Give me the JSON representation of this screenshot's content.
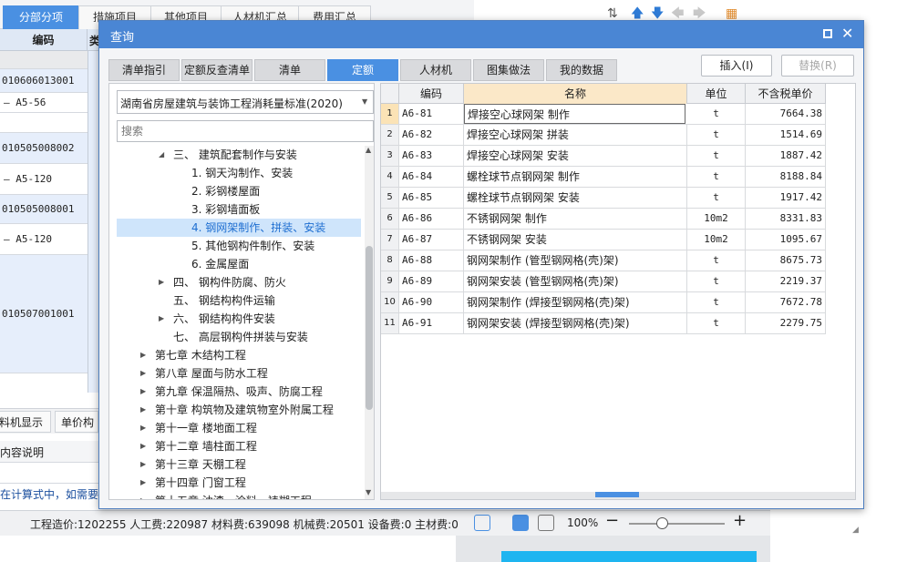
{
  "background": {
    "tabs": [
      "分部分项",
      "措施项目",
      "其他项目",
      "人材机汇总",
      "费用汇总"
    ],
    "column_header": "编码",
    "column_header_cut": "类",
    "rows": [
      {
        "text": "010606013001",
        "style": "blue"
      },
      {
        "text": "A5-56",
        "style": "white"
      },
      {
        "text": "",
        "style": "white"
      },
      {
        "text": "010505008002",
        "style": "blue"
      },
      {
        "text": "A5-120",
        "style": "white"
      },
      {
        "text": "010505008001",
        "style": "blue"
      },
      {
        "text": "A5-120",
        "style": "white"
      },
      {
        "text": "010507001001",
        "style": "blue"
      }
    ],
    "bottom_tabs": [
      "料机显示",
      "单价构"
    ],
    "sub_header": "内容说明",
    "hint": "在计算式中，如需要注",
    "status": {
      "cost_text": "工程造价:1202255  人工费:220987  材料费:639098  机械费:20501  设备费:0  主材费:0",
      "zoom": "100%",
      "zoom_fraction": 0.3
    }
  },
  "dialog": {
    "title": "查询",
    "tabs": [
      "清单指引",
      "定额反查清单",
      "清单",
      "定额",
      "人材机",
      "图集做法",
      "我的数据"
    ],
    "active_tab": "定额",
    "buttons": {
      "insert": "插入(I)",
      "replace": "替换(R)"
    },
    "standard_select": "湖南省房屋建筑与装饰工程消耗量标准(2020)",
    "search_placeholder": "搜索",
    "tree": [
      {
        "label": "三、 建筑配套制作与安装",
        "level": 1,
        "arrow": "down"
      },
      {
        "label": "1. 钢天沟制作、安装",
        "level": 2
      },
      {
        "label": "2. 彩钢楼屋面",
        "level": 2
      },
      {
        "label": "3. 彩钢墙面板",
        "level": 2
      },
      {
        "label": "4. 钢网架制作、拼装、安装",
        "level": 2,
        "selected": true
      },
      {
        "label": "5. 其他钢构件制作、安装",
        "level": 2
      },
      {
        "label": "6. 金属屋面",
        "level": 2
      },
      {
        "label": "四、 钢构件防腐、防火",
        "level": 1,
        "arrow": "right"
      },
      {
        "label": "五、 钢结构构件运输",
        "level": 1
      },
      {
        "label": "六、 钢结构构件安装",
        "level": 1,
        "arrow": "right"
      },
      {
        "label": "七、 高层钢构件拼装与安装",
        "level": 1
      },
      {
        "label": "第七章 木结构工程",
        "level": 0,
        "arrow": "right"
      },
      {
        "label": "第八章 屋面与防水工程",
        "level": 0,
        "arrow": "right"
      },
      {
        "label": "第九章 保温隔热、吸声、防腐工程",
        "level": 0,
        "arrow": "right"
      },
      {
        "label": "第十章 构筑物及建筑物室外附属工程",
        "level": 0,
        "arrow": "right"
      },
      {
        "label": "第十一章 楼地面工程",
        "level": 0,
        "arrow": "right"
      },
      {
        "label": "第十二章 墙柱面工程",
        "level": 0,
        "arrow": "right"
      },
      {
        "label": "第十三章 天棚工程",
        "level": 0,
        "arrow": "right"
      },
      {
        "label": "第十四章 门窗工程",
        "level": 0,
        "arrow": "right"
      },
      {
        "label": "第十五章 油漆、涂料、裱糊工程",
        "level": 0,
        "arrow": "right"
      }
    ],
    "grid": {
      "headers": {
        "index": "",
        "code": "编码",
        "name": "名称",
        "unit": "单位",
        "price": "不含税单价"
      },
      "rows": [
        {
          "idx": "1",
          "code": "A6-81",
          "name": "焊接空心球网架 制作",
          "unit": "t",
          "price": "7664.38"
        },
        {
          "idx": "2",
          "code": "A6-82",
          "name": "焊接空心球网架 拼装",
          "unit": "t",
          "price": "1514.69"
        },
        {
          "idx": "3",
          "code": "A6-83",
          "name": "焊接空心球网架 安装",
          "unit": "t",
          "price": "1887.42"
        },
        {
          "idx": "4",
          "code": "A6-84",
          "name": "螺栓球节点钢网架 制作",
          "unit": "t",
          "price": "8188.84"
        },
        {
          "idx": "5",
          "code": "A6-85",
          "name": "螺栓球节点钢网架 安装",
          "unit": "t",
          "price": "1917.42"
        },
        {
          "idx": "6",
          "code": "A6-86",
          "name": "不锈钢网架 制作",
          "unit": "10m2",
          "price": "8331.83"
        },
        {
          "idx": "7",
          "code": "A6-87",
          "name": "不锈钢网架 安装",
          "unit": "10m2",
          "price": "1095.67"
        },
        {
          "idx": "8",
          "code": "A6-88",
          "name": "钢网架制作 (管型钢网格(壳)架)",
          "unit": "t",
          "price": "8675.73"
        },
        {
          "idx": "9",
          "code": "A6-89",
          "name": "钢网架安装 (管型钢网格(壳)架)",
          "unit": "t",
          "price": "2219.37"
        },
        {
          "idx": "10",
          "code": "A6-90",
          "name": "钢网架制作 (焊接型钢网格(壳)架)",
          "unit": "t",
          "price": "7672.78"
        },
        {
          "idx": "11",
          "code": "A6-91",
          "name": "钢网架安装 (焊接型钢网格(壳)架)",
          "unit": "t",
          "price": "2279.75"
        }
      ]
    }
  },
  "icons": [
    "sort-icon",
    "arrow-up-icon",
    "arrow-down-icon",
    "arrow-left-icon",
    "arrow-right-icon",
    "filter-icon",
    "maximize-icon",
    "close-icon",
    "chevron-down-icon",
    "expand-arrow-icon",
    "collapse-arrow-icon",
    "scroll-up-icon",
    "scroll-down-icon",
    "layout-icon",
    "zoom-minus-icon",
    "zoom-plus-icon"
  ],
  "colors": {
    "accent": "#4a90e2",
    "title_bar": "#4a86d4",
    "selection": "#cfe5fb",
    "header_highlight": "#fbe8c8"
  }
}
